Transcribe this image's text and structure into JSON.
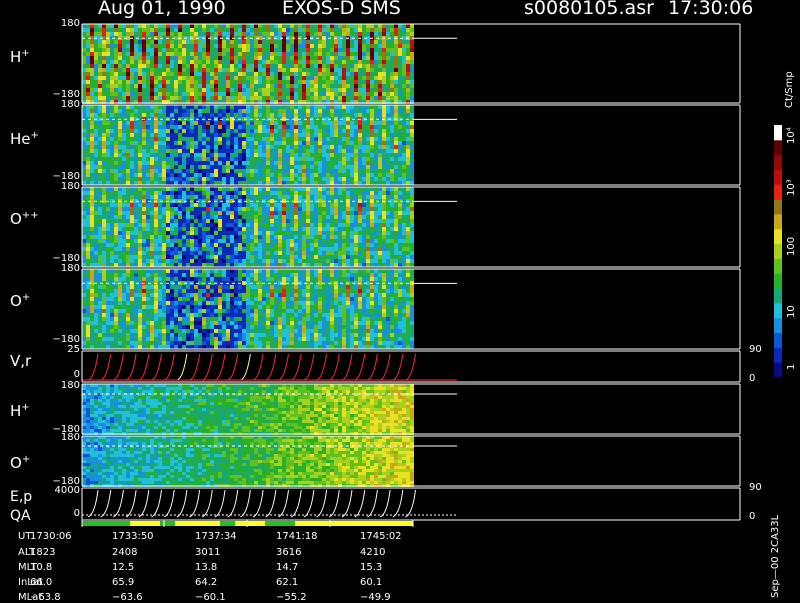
{
  "header": {
    "date": "Aug 01, 1990",
    "instrument": "EXOS-D SMS",
    "filename": "s0080105.asr",
    "time": "17:30:06"
  },
  "panels": [
    {
      "id": "h_plus",
      "label": "H",
      "sup": "+",
      "ymax": "180",
      "ymin": "−180"
    },
    {
      "id": "he_plus",
      "label": "He",
      "sup": "+",
      "ymax": "180",
      "ymin": "−180"
    },
    {
      "id": "o_pp",
      "label": "O",
      "sup": "++",
      "ymax": "180",
      "ymin": "−180"
    },
    {
      "id": "o_plus",
      "label": "O",
      "sup": "+",
      "ymax": "180",
      "ymin": "−180"
    },
    {
      "id": "vr",
      "label": "V,r",
      "sup": "",
      "ymax": "25",
      "ymin": "0",
      "rmax": "90",
      "rmin": "0"
    },
    {
      "id": "h_plus_2",
      "label": "H",
      "sup": "+",
      "ymax": "180",
      "ymin": "−180"
    },
    {
      "id": "o_plus_2",
      "label": "O",
      "sup": "+",
      "ymax": "180",
      "ymin": "−180"
    },
    {
      "id": "ep",
      "label": "E,p",
      "sup": "",
      "label2": "QA",
      "ymax": "4000",
      "ymin": "0",
      "rmax": "90",
      "rmin": "0"
    }
  ],
  "colorbar": {
    "unit": "Ct/Smp",
    "ticks": [
      "1",
      "10",
      "100",
      "10³",
      "10⁴"
    ],
    "colors": [
      "#0a0a80",
      "#0b2ab8",
      "#0f55d8",
      "#1890e0",
      "#22c0d8",
      "#18a878",
      "#28b028",
      "#60c020",
      "#a8d020",
      "#e8e020",
      "#c8a818",
      "#907818",
      "#e82010",
      "#b81010",
      "#900808",
      "#600000",
      "#ffffff"
    ]
  },
  "ephemeris": {
    "rows": [
      {
        "name": "UT",
        "values": [
          "1730:06",
          "1733:50",
          "1737:34",
          "1741:18",
          "1745:02"
        ]
      },
      {
        "name": "ALT",
        "values": [
          "1823",
          "2408",
          "3011",
          "3616",
          "4210"
        ]
      },
      {
        "name": "MLT",
        "values": [
          "10.8",
          "12.5",
          "13.8",
          "14.7",
          "15.3"
        ]
      },
      {
        "name": "InLat",
        "values": [
          "66.0",
          "65.9",
          "64.2",
          "62.1",
          "60.1"
        ]
      },
      {
        "name": "MLat",
        "values": [
          "−63.8",
          "−63.6",
          "−60.1",
          "−55.2",
          "−49.9"
        ]
      }
    ]
  },
  "footer_note": "Sep—00  2CA33L",
  "chart_data": {
    "type": "heatmap",
    "title": "Aug 01, 1990   EXOS-D SMS",
    "x_time_ticks": [
      "1730:06",
      "1733:50",
      "1737:34",
      "1741:18",
      "1745:02"
    ],
    "y_range_pitch": [
      -180,
      180
    ],
    "colorscale": "log",
    "colorbar_range": [
      1,
      10000
    ],
    "colorbar_label": "Ct/Smp",
    "series": [
      {
        "name": "H+"
      },
      {
        "name": "He+"
      },
      {
        "name": "O++"
      },
      {
        "name": "O+"
      },
      {
        "name": "V,r"
      },
      {
        "name": "H+"
      },
      {
        "name": "O+"
      },
      {
        "name": "E,p"
      }
    ]
  }
}
